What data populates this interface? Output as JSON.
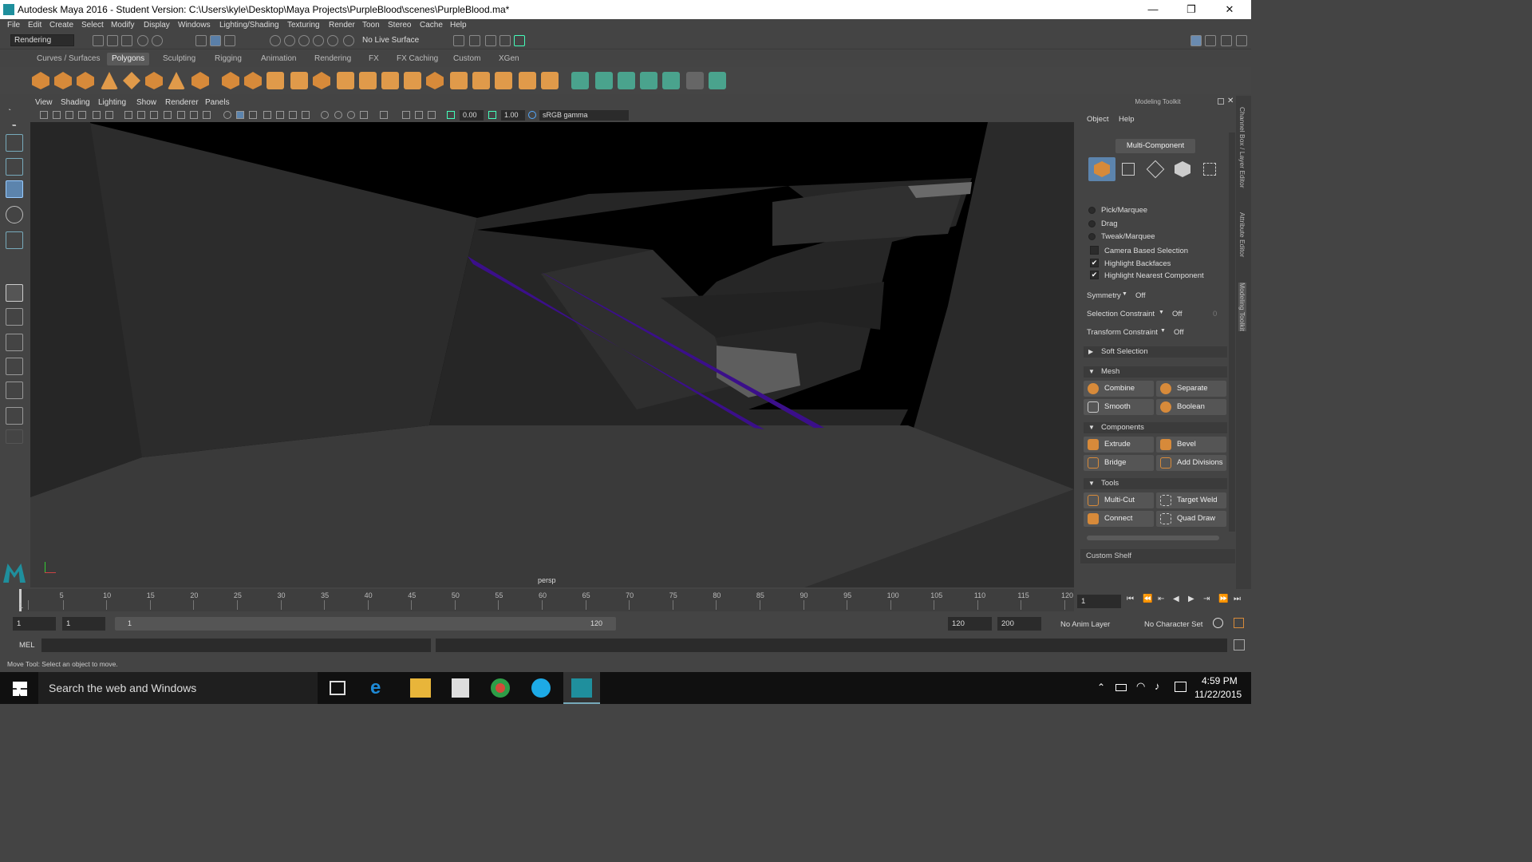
{
  "window": {
    "title": "Autodesk Maya 2016 - Student Version: C:\\Users\\kyle\\Desktop\\Maya Projects\\PurpleBlood\\scenes\\PurpleBlood.ma*",
    "minimize": "—",
    "restore": "❐",
    "close": "✕"
  },
  "menubar": [
    "File",
    "Edit",
    "Create",
    "Select",
    "Modify",
    "Display",
    "Windows",
    "Lighting/Shading",
    "Texturing",
    "Render",
    "Toon",
    "Stereo",
    "Cache",
    "Help"
  ],
  "statusline": {
    "menuset": "Rendering",
    "live_surface": "No Live Surface"
  },
  "shelf_tabs": [
    "Curves / Surfaces",
    "Polygons",
    "Sculpting",
    "Rigging",
    "Animation",
    "Rendering",
    "FX",
    "FX Caching",
    "Custom",
    "XGen"
  ],
  "shelf_active_tab": "Polygons",
  "viewport": {
    "menus": [
      "View",
      "Shading",
      "Lighting",
      "Show",
      "Renderer",
      "Panels"
    ],
    "exposure": "0.00",
    "gamma": "1.00",
    "color_space": "sRGB gamma",
    "camera_label": "persp",
    "accent_purple": "#3b0f8a"
  },
  "modeling_toolkit": {
    "title": "Modeling Toolkit",
    "menus": [
      "Object",
      "Help"
    ],
    "mode_button": "Multi-Component",
    "select_modes": [
      "Pick/Marquee",
      "Drag",
      "Tweak/Marquee"
    ],
    "checkboxes": [
      {
        "label": "Camera Based Selection",
        "checked": ""
      },
      {
        "label": "Highlight Backfaces",
        "checked": "✔"
      },
      {
        "label": "Highlight Nearest Component",
        "checked": "✔"
      }
    ],
    "symmetry": {
      "label": "Symmetry",
      "value": "Off"
    },
    "selection_constraint": {
      "label": "Selection Constraint",
      "value": "Off",
      "num": "0"
    },
    "transform_constraint": {
      "label": "Transform Constraint",
      "value": "Off"
    },
    "soft_selection": "Soft Selection",
    "sections": {
      "mesh": {
        "title": "Mesh",
        "buttons": [
          "Combine",
          "Separate",
          "Smooth",
          "Boolean"
        ]
      },
      "components": {
        "title": "Components",
        "buttons": [
          "Extrude",
          "Bevel",
          "Bridge",
          "Add Divisions"
        ]
      },
      "tools": {
        "title": "Tools",
        "buttons": [
          "Multi-Cut",
          "Target Weld",
          "Connect",
          "Quad Draw"
        ]
      }
    },
    "custom_shelf": "Custom Shelf"
  },
  "side_tabs": [
    "Channel Box / Layer Editor",
    "Attribute Editor",
    "Modeling Toolkit"
  ],
  "timeline": {
    "ticks": [
      "1",
      "5",
      "10",
      "15",
      "20",
      "25",
      "30",
      "35",
      "40",
      "45",
      "50",
      "55",
      "60",
      "65",
      "70",
      "75",
      "80",
      "85",
      "90",
      "95",
      "100",
      "105",
      "110",
      "115",
      "120"
    ],
    "current_frame": "1"
  },
  "range": {
    "start": "1",
    "playback_start": "1",
    "slider_start": "1",
    "slider_end": "120",
    "playback_end": "120",
    "end": "200",
    "anim_layer": "No Anim Layer",
    "character_set": "No Character Set"
  },
  "command_line": {
    "label": "MEL"
  },
  "help_line": "Move Tool: Select an object to move.",
  "taskbar": {
    "search": "Search the web and Windows",
    "time": "4:59 PM",
    "date": "11/22/2015"
  }
}
